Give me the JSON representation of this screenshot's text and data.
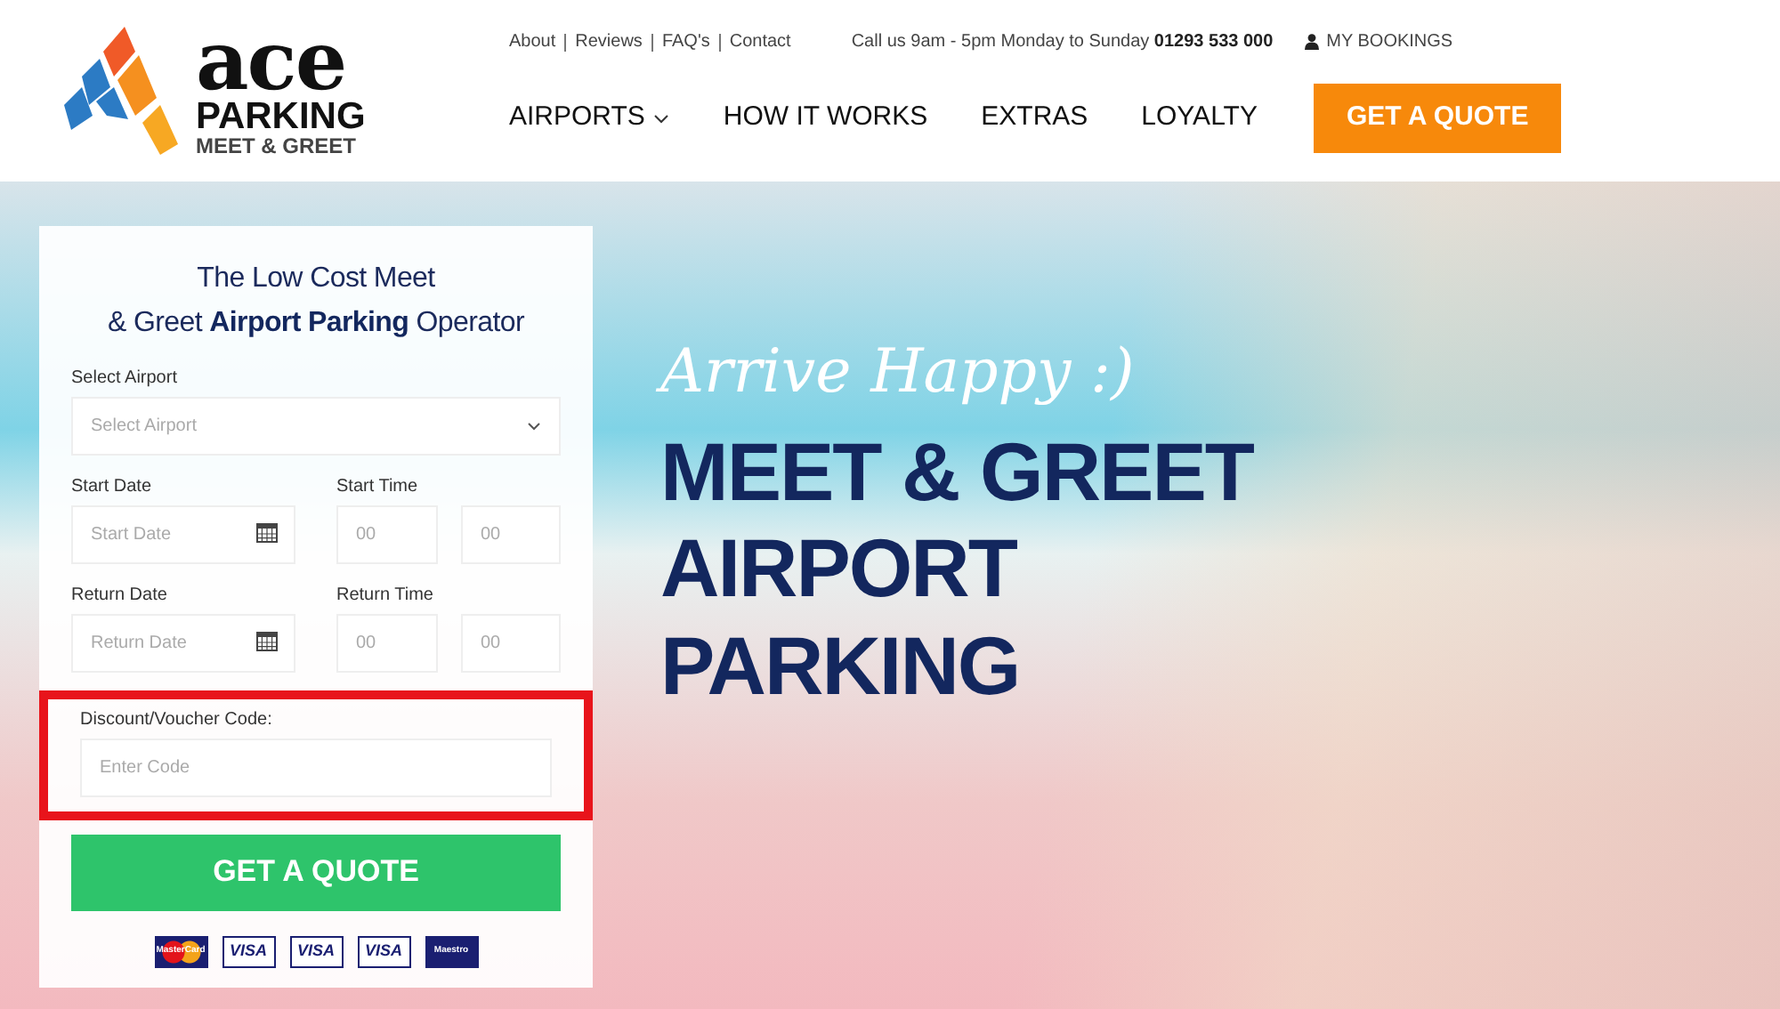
{
  "logo": {
    "word": "ace",
    "line_1": "PARKING",
    "line_2": "MEET & GREET"
  },
  "top_links": [
    "About",
    "Reviews",
    "FAQ's",
    "Contact"
  ],
  "call_info": {
    "text": "Call us 9am - 5pm Monday to Sunday",
    "phone": "01293 533 000"
  },
  "my_bookings": "MY BOOKINGS",
  "nav": [
    {
      "label": "AIRPORTS",
      "dropdown": true
    },
    {
      "label": "HOW IT WORKS",
      "dropdown": false
    },
    {
      "label": "EXTRAS",
      "dropdown": false
    },
    {
      "label": "LOYALTY",
      "dropdown": false
    }
  ],
  "nav_cta": "GET A QUOTE",
  "form": {
    "title_1": "The Low Cost Meet",
    "title_2": "& Greet **Airport Parking** Operator",
    "airport": {
      "label": "Select Airport",
      "placeholder": "Select Airport"
    },
    "start_date": {
      "label": "Start Date",
      "placeholder": "Start Date"
    },
    "start_time": {
      "label": "Start Time",
      "hour": "00",
      "minute": "00"
    },
    "return_date": {
      "label": "Return Date",
      "placeholder": "Return Date"
    },
    "return_time": {
      "label": "Return Time",
      "hour": "00",
      "minute": "00"
    },
    "voucher": {
      "label": "Discount/Voucher Code:",
      "placeholder": "Enter Code",
      "highlighted": true
    },
    "submit": "GET A QUOTE",
    "payment_cards": [
      {
        "kind": "mastercard",
        "label": "MasterCard"
      },
      {
        "kind": "visa",
        "label": "VISA"
      },
      {
        "kind": "visa",
        "label": "VISA"
      },
      {
        "kind": "visa",
        "label": "VISA"
      },
      {
        "kind": "maestro",
        "label": "Maestro"
      }
    ]
  },
  "hero": {
    "tagline": "Arrive Happy :)",
    "headline": [
      "MEET & GREET",
      "AIRPORT",
      "PARKING"
    ]
  }
}
